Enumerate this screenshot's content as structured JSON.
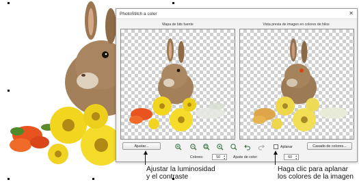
{
  "dialog": {
    "title": "PhotoStitch a color",
    "close_label": "✕",
    "left_panel_label": "Mapa de bits fuente",
    "right_panel_label": "Vista previa de imagen en colores de hilos",
    "adjust_button": "Ajustar...",
    "flatten_label": "Aplanar",
    "flatten_checked": false,
    "thread_match_button": "Casado de colores...",
    "colors_label": "Colores:",
    "colors_value": "50",
    "color_adjust_label": "Ajuste de color:",
    "color_adjust_value": "60",
    "toolbar_icons": [
      "zoom-in-icon",
      "zoom-out-icon",
      "zoom-box-icon",
      "zoom-fit-icon",
      "zoom-all-icon",
      "undo-icon",
      "redo-icon"
    ]
  },
  "callouts": {
    "left_line1": "Ajustar la luminosidad",
    "left_line2": "y el contraste",
    "right_line1": "Haga clic para aplanar",
    "right_line2": "los colores de la imagen"
  },
  "colors": {
    "fur": "#9b7a55",
    "fur_light": "#c9ae8c",
    "daisy_yellow": "#f2d51f",
    "daisy_center": "#b08a14",
    "orange_flower": "#e8531f",
    "leaf": "#5a8a2a"
  }
}
